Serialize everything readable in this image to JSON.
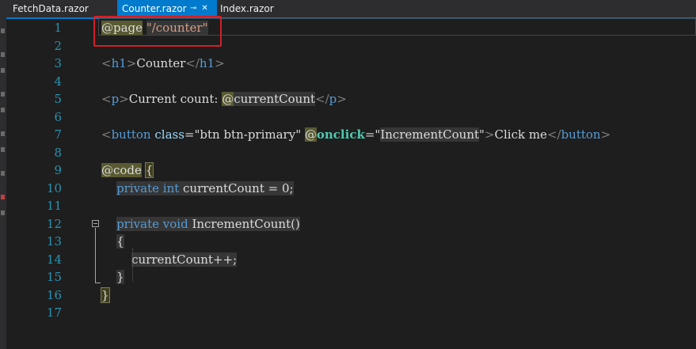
{
  "tabs": [
    {
      "label": "FetchData.razor",
      "active": false
    },
    {
      "label": "Counter.razor",
      "active": true
    },
    {
      "label": "Index.razor",
      "active": false
    }
  ],
  "tab_icons": {
    "pin": "⊸",
    "close": "✕"
  },
  "colors": {
    "accent": "#007acc",
    "highlight_box": "#d21f28",
    "line_number": "#2b91af",
    "keyword": "#569cd6",
    "string": "#d69d85"
  },
  "line_numbers": [
    "1",
    "2",
    "3",
    "4",
    "5",
    "6",
    "7",
    "8",
    "9",
    "10",
    "11",
    "12",
    "13",
    "14",
    "15",
    "16",
    "17"
  ],
  "code": {
    "l1": {
      "directive": "@page",
      "route": "\"/counter\""
    },
    "l3": {
      "open_lt": "<",
      "tag": "h1",
      "open_gt": ">",
      "text": "Counter",
      "close_lt": "</",
      "close_tag": "h1",
      "close_gt": ">"
    },
    "l5": {
      "open_lt": "<",
      "tag": "p",
      "open_gt": ">",
      "text": "Current count: ",
      "at": "@",
      "expr": "currentCount",
      "close_lt": "</",
      "close_tag": "p",
      "close_gt": ">"
    },
    "l7": {
      "open_lt": "<",
      "tag": "button",
      "sp1": " ",
      "attr1": "class",
      "eq1": "=",
      "val1": "\"btn btn-primary\"",
      "sp2": " ",
      "at": "@",
      "attr2": "onclick",
      "eq2": "=\"",
      "val2": "IncrementCount",
      "q2": "\"",
      "gt": ">",
      "text": "Click me",
      "close_lt": "</",
      "close_tag": "button",
      "close_gt": ">"
    },
    "l9": {
      "directive": "@code",
      "sp": " ",
      "brace": "{"
    },
    "l10": {
      "indent": "    ",
      "kw1": "private",
      "sp1": " ",
      "kw2": "int",
      "rest": " currentCount = 0;"
    },
    "l12": {
      "indent": "    ",
      "kw1": "private",
      "sp1": " ",
      "kw2": "void",
      "rest": " IncrementCount()"
    },
    "l13": {
      "indent": "    ",
      "brace": "{"
    },
    "l14": {
      "indent": "        ",
      "stmt": "currentCount++;"
    },
    "l15": {
      "indent": "    ",
      "brace": "}"
    },
    "l16": {
      "brace": "}"
    }
  }
}
